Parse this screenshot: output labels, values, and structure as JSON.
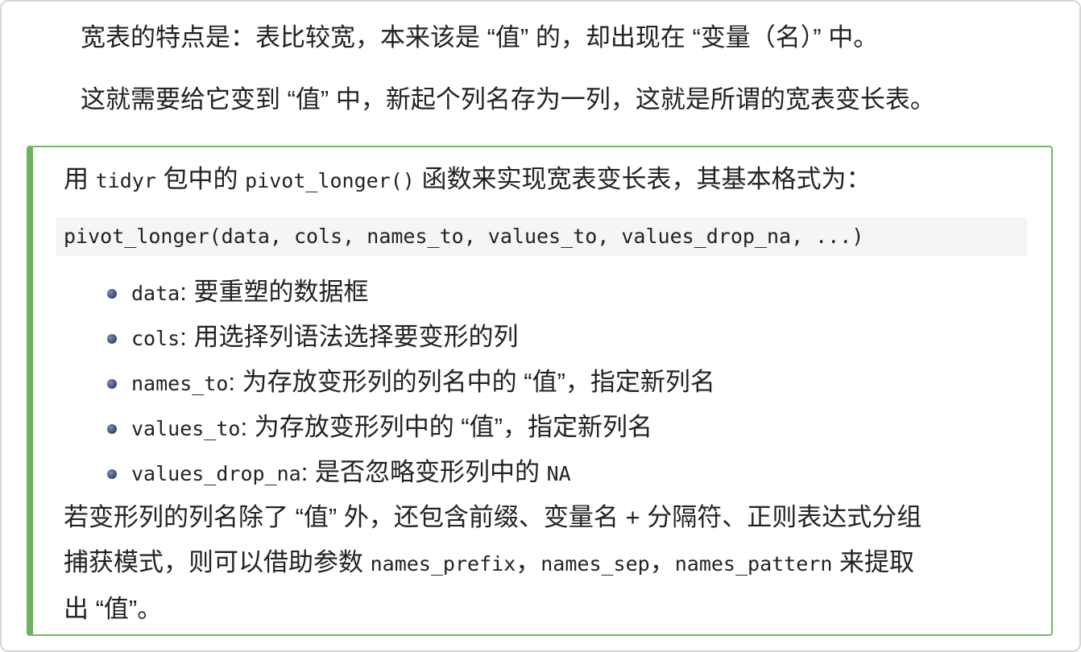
{
  "paragraphs": {
    "p1": "宽表的特点是：表比较宽，本来该是 “值” 的，却出现在 “变量（名）” 中。",
    "p2": "这就需要给它变到 “值” 中，新起个列名存为一列，这就是所谓的宽表变长表。"
  },
  "callout": {
    "intro_pre": "用 ",
    "intro_pkg": "tidyr",
    "intro_mid": " 包中的 ",
    "intro_func": "pivot_longer()",
    "intro_post": " 函数来实现宽表变长表，其基本格式为：",
    "code": "pivot_longer(data, cols, names_to, values_to, values_drop_na, ...)",
    "bullets": [
      {
        "code": "data",
        "text": ": 要重塑的数据框"
      },
      {
        "code": "cols",
        "text": ": 用选择列语法选择要变形的列"
      },
      {
        "code": "names_to",
        "text": ": 为存放变形列的列名中的 “值”，指定新列名"
      },
      {
        "code": "values_to",
        "text": ": 为存放变形列中的 “值”，指定新列名"
      },
      {
        "code": "values_drop_na",
        "text": ": 是否忽略变形列中的 ",
        "code2": "NA"
      }
    ],
    "outro": {
      "line1": "若变形列的列名除了 “值” 外，还包含前缀、变量名 + 分隔符、正则表达式分组",
      "line2_pre": "捕获模式，则可以借助参数 ",
      "arg1": "names_prefix",
      "sep1": "，",
      "arg2": "names_sep",
      "sep2": "，",
      "arg3": "names_pattern",
      "line2_post": " 来提取",
      "line3": "出 “值”。"
    }
  }
}
